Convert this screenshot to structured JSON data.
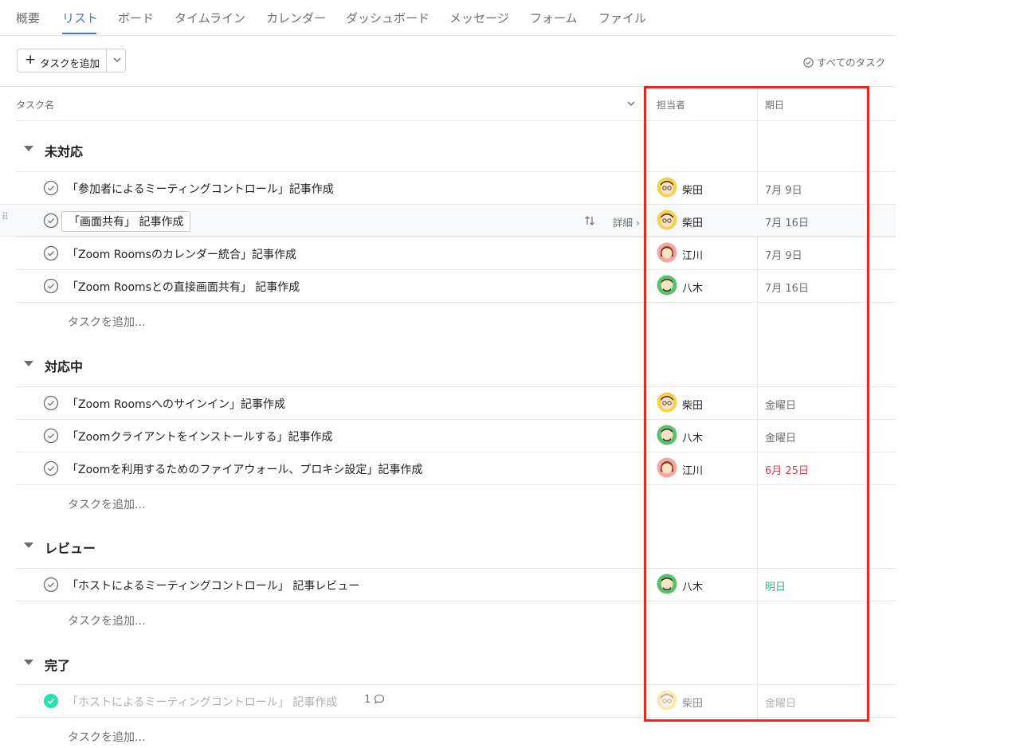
{
  "tabs": [
    "概要",
    "リスト",
    "ボード",
    "タイムライン",
    "カレンダー",
    "ダッシュボード",
    "メッセージ",
    "フォーム",
    "ファイル"
  ],
  "toolbar": {
    "add_task_label": "タスクを追加",
    "all_tasks_label": "すべてのタスク"
  },
  "columns": {
    "task_name": "タスク名",
    "assignee": "担当者",
    "due": "期日"
  },
  "add_task_link": "タスクを追加...",
  "sections": [
    {
      "title": "未対応",
      "tasks": [
        {
          "name": "「参加者によるミーティングコントロール」記事作成",
          "assignee": "柴田",
          "due": "7月 9日"
        },
        {
          "name": "「画面共有」 記事作成",
          "assignee": "柴田",
          "due": "7月 16日",
          "detail": "詳細"
        },
        {
          "name": "「Zoom Roomsのカレンダー統合」記事作成",
          "assignee": "江川",
          "due": "7月 9日"
        },
        {
          "name": "「Zoom Roomsとの直接画面共有」 記事作成",
          "assignee": "八木",
          "due": "7月 16日"
        }
      ]
    },
    {
      "title": "対応中",
      "tasks": [
        {
          "name": "「Zoom Roomsへのサインイン」記事作成",
          "assignee": "柴田",
          "due": "金曜日"
        },
        {
          "name": "「Zoomクライアントをインストールする」記事作成",
          "assignee": "八木",
          "due": "金曜日"
        },
        {
          "name": "「Zoomを利用するためのファイアウォール、プロキシ設定」記事作成",
          "assignee": "江川",
          "due": "6月 25日"
        }
      ]
    },
    {
      "title": "レビュー",
      "tasks": [
        {
          "name": "「ホストによるミーティングコントロール」 記事レビュー",
          "assignee": "八木",
          "due": "明日"
        }
      ]
    },
    {
      "title": "完了",
      "tasks": [
        {
          "name": "「ホストによるミーティングコントロール」 記事作成",
          "assignee": "柴田",
          "due": "金曜日",
          "comments": "1"
        }
      ]
    }
  ],
  "colors": {
    "accent": "#4573d2",
    "overdue": "#e8384f",
    "tomorrow": "#2fb58e",
    "done_check": "#2ce0ae",
    "highlight": "#e8281e"
  }
}
